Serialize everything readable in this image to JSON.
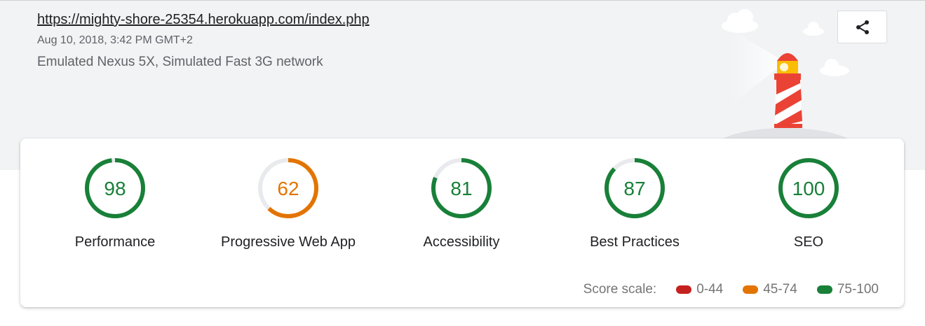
{
  "report": {
    "url": "https://mighty-shore-25354.herokuapp.com/index.php",
    "timestamp": "Aug 10, 2018, 3:42 PM GMT+2",
    "device": "Emulated Nexus 5X, Simulated Fast 3G network"
  },
  "share": {
    "icon": "share-icon"
  },
  "colors": {
    "pass": "#188038",
    "average": "#e37400",
    "fail": "#c5221f",
    "track": "#e8eaed"
  },
  "gauges": [
    {
      "label": "Performance",
      "score": "98",
      "rating": "pass"
    },
    {
      "label": "Progressive Web App",
      "score": "62",
      "rating": "average"
    },
    {
      "label": "Accessibility",
      "score": "81",
      "rating": "pass"
    },
    {
      "label": "Best Practices",
      "score": "87",
      "rating": "pass"
    },
    {
      "label": "SEO",
      "score": "100",
      "rating": "pass"
    }
  ],
  "score_scale": {
    "label": "Score scale:",
    "ranges": [
      {
        "text": "0-44",
        "color": "#c5221f"
      },
      {
        "text": "45-74",
        "color": "#e37400"
      },
      {
        "text": "75-100",
        "color": "#188038"
      }
    ]
  }
}
